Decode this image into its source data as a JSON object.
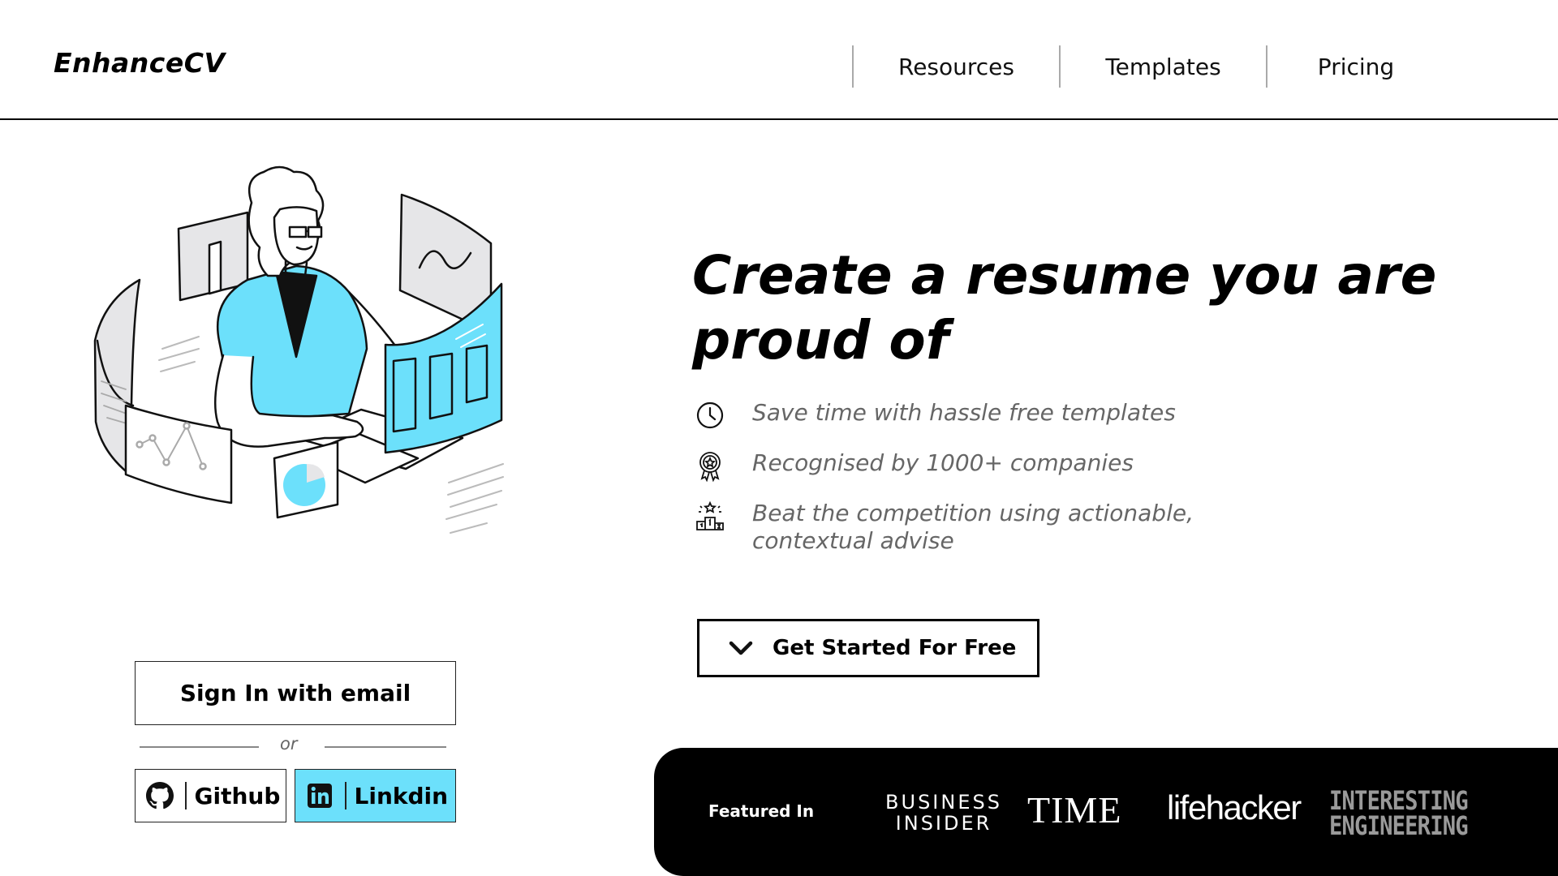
{
  "header": {
    "logo": "EnhanceCV",
    "nav": [
      "Resources",
      "Templates",
      "Pricing"
    ]
  },
  "hero": {
    "title": "Create a resume you are proud of",
    "features": [
      {
        "icon": "clock-icon",
        "text": "Save time with hassle free templates"
      },
      {
        "icon": "award-badge-icon",
        "text": "Recognised by 1000+ companies"
      },
      {
        "icon": "podium-icon",
        "text": "Beat the competition using actionable, contextual advise"
      }
    ],
    "cta_label": "Get Started For Free"
  },
  "auth": {
    "signin_label": "Sign In with email",
    "or_text": "or",
    "github_label": "Github",
    "linkedin_label": "Linkdin"
  },
  "featured": {
    "label": "Featured In",
    "brands": [
      "BUSINESS INSIDER",
      "TIME",
      "lifehacker",
      "INTERESTING ENGINEERING"
    ]
  },
  "colors": {
    "accent": "#6ce0fb",
    "text_muted": "#666666",
    "featured_bg": "#000000"
  }
}
